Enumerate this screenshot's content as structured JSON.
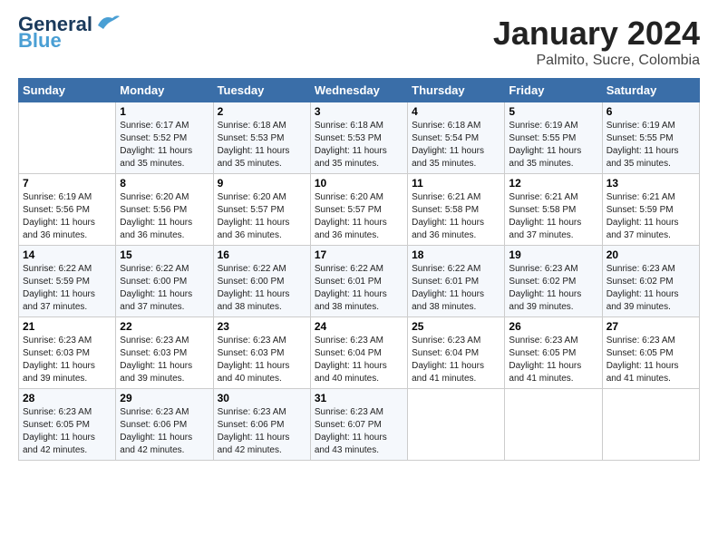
{
  "logo": {
    "line1": "General",
    "line2": "Blue"
  },
  "header": {
    "month": "January 2024",
    "location": "Palmito, Sucre, Colombia"
  },
  "weekdays": [
    "Sunday",
    "Monday",
    "Tuesday",
    "Wednesday",
    "Thursday",
    "Friday",
    "Saturday"
  ],
  "weeks": [
    [
      {
        "day": "",
        "info": ""
      },
      {
        "day": "1",
        "info": "Sunrise: 6:17 AM\nSunset: 5:52 PM\nDaylight: 11 hours\nand 35 minutes."
      },
      {
        "day": "2",
        "info": "Sunrise: 6:18 AM\nSunset: 5:53 PM\nDaylight: 11 hours\nand 35 minutes."
      },
      {
        "day": "3",
        "info": "Sunrise: 6:18 AM\nSunset: 5:53 PM\nDaylight: 11 hours\nand 35 minutes."
      },
      {
        "day": "4",
        "info": "Sunrise: 6:18 AM\nSunset: 5:54 PM\nDaylight: 11 hours\nand 35 minutes."
      },
      {
        "day": "5",
        "info": "Sunrise: 6:19 AM\nSunset: 5:55 PM\nDaylight: 11 hours\nand 35 minutes."
      },
      {
        "day": "6",
        "info": "Sunrise: 6:19 AM\nSunset: 5:55 PM\nDaylight: 11 hours\nand 35 minutes."
      }
    ],
    [
      {
        "day": "7",
        "info": "Sunrise: 6:19 AM\nSunset: 5:56 PM\nDaylight: 11 hours\nand 36 minutes."
      },
      {
        "day": "8",
        "info": "Sunrise: 6:20 AM\nSunset: 5:56 PM\nDaylight: 11 hours\nand 36 minutes."
      },
      {
        "day": "9",
        "info": "Sunrise: 6:20 AM\nSunset: 5:57 PM\nDaylight: 11 hours\nand 36 minutes."
      },
      {
        "day": "10",
        "info": "Sunrise: 6:20 AM\nSunset: 5:57 PM\nDaylight: 11 hours\nand 36 minutes."
      },
      {
        "day": "11",
        "info": "Sunrise: 6:21 AM\nSunset: 5:58 PM\nDaylight: 11 hours\nand 36 minutes."
      },
      {
        "day": "12",
        "info": "Sunrise: 6:21 AM\nSunset: 5:58 PM\nDaylight: 11 hours\nand 37 minutes."
      },
      {
        "day": "13",
        "info": "Sunrise: 6:21 AM\nSunset: 5:59 PM\nDaylight: 11 hours\nand 37 minutes."
      }
    ],
    [
      {
        "day": "14",
        "info": "Sunrise: 6:22 AM\nSunset: 5:59 PM\nDaylight: 11 hours\nand 37 minutes."
      },
      {
        "day": "15",
        "info": "Sunrise: 6:22 AM\nSunset: 6:00 PM\nDaylight: 11 hours\nand 37 minutes."
      },
      {
        "day": "16",
        "info": "Sunrise: 6:22 AM\nSunset: 6:00 PM\nDaylight: 11 hours\nand 38 minutes."
      },
      {
        "day": "17",
        "info": "Sunrise: 6:22 AM\nSunset: 6:01 PM\nDaylight: 11 hours\nand 38 minutes."
      },
      {
        "day": "18",
        "info": "Sunrise: 6:22 AM\nSunset: 6:01 PM\nDaylight: 11 hours\nand 38 minutes."
      },
      {
        "day": "19",
        "info": "Sunrise: 6:23 AM\nSunset: 6:02 PM\nDaylight: 11 hours\nand 39 minutes."
      },
      {
        "day": "20",
        "info": "Sunrise: 6:23 AM\nSunset: 6:02 PM\nDaylight: 11 hours\nand 39 minutes."
      }
    ],
    [
      {
        "day": "21",
        "info": "Sunrise: 6:23 AM\nSunset: 6:03 PM\nDaylight: 11 hours\nand 39 minutes."
      },
      {
        "day": "22",
        "info": "Sunrise: 6:23 AM\nSunset: 6:03 PM\nDaylight: 11 hours\nand 39 minutes."
      },
      {
        "day": "23",
        "info": "Sunrise: 6:23 AM\nSunset: 6:03 PM\nDaylight: 11 hours\nand 40 minutes."
      },
      {
        "day": "24",
        "info": "Sunrise: 6:23 AM\nSunset: 6:04 PM\nDaylight: 11 hours\nand 40 minutes."
      },
      {
        "day": "25",
        "info": "Sunrise: 6:23 AM\nSunset: 6:04 PM\nDaylight: 11 hours\nand 41 minutes."
      },
      {
        "day": "26",
        "info": "Sunrise: 6:23 AM\nSunset: 6:05 PM\nDaylight: 11 hours\nand 41 minutes."
      },
      {
        "day": "27",
        "info": "Sunrise: 6:23 AM\nSunset: 6:05 PM\nDaylight: 11 hours\nand 41 minutes."
      }
    ],
    [
      {
        "day": "28",
        "info": "Sunrise: 6:23 AM\nSunset: 6:05 PM\nDaylight: 11 hours\nand 42 minutes."
      },
      {
        "day": "29",
        "info": "Sunrise: 6:23 AM\nSunset: 6:06 PM\nDaylight: 11 hours\nand 42 minutes."
      },
      {
        "day": "30",
        "info": "Sunrise: 6:23 AM\nSunset: 6:06 PM\nDaylight: 11 hours\nand 42 minutes."
      },
      {
        "day": "31",
        "info": "Sunrise: 6:23 AM\nSunset: 6:07 PM\nDaylight: 11 hours\nand 43 minutes."
      },
      {
        "day": "",
        "info": ""
      },
      {
        "day": "",
        "info": ""
      },
      {
        "day": "",
        "info": ""
      }
    ]
  ]
}
